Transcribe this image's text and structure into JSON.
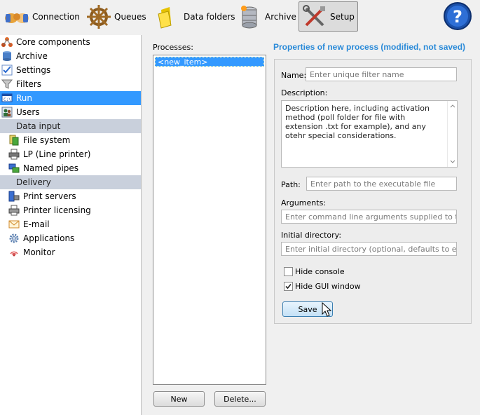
{
  "toolbar": {
    "connection": "Connection",
    "queues": "Queues",
    "data_folders": "Data folders",
    "archive": "Archive",
    "setup": "Setup"
  },
  "nav": {
    "items": [
      {
        "label": "Core components",
        "icon": "core-components-icon"
      },
      {
        "label": "Archive",
        "icon": "database-icon"
      },
      {
        "label": "Settings",
        "icon": "checklist-icon"
      },
      {
        "label": "Filters",
        "icon": "funnel-icon"
      },
      {
        "label": "Run",
        "icon": "run-icon"
      },
      {
        "label": "Users",
        "icon": "users-icon"
      }
    ],
    "group_data_input": "Data input",
    "data_input_items": [
      {
        "label": "File system"
      },
      {
        "label": "LP (Line printer)"
      },
      {
        "label": "Named pipes"
      }
    ],
    "group_delivery": "Delivery",
    "delivery_items": [
      {
        "label": "Print servers"
      },
      {
        "label": "Printer licensing"
      },
      {
        "label": "E-mail"
      },
      {
        "label": "Applications"
      },
      {
        "label": "Monitor"
      }
    ]
  },
  "processes": {
    "label": "Processes:",
    "items": [
      "<new_item>"
    ],
    "new_button": "New",
    "delete_button": "Delete..."
  },
  "properties": {
    "title": "Properties of new process (modified, not saved)",
    "name_label": "Name:",
    "name_placeholder": "Enter unique filter name",
    "description_label": "Description:",
    "description_value": "Description here, including activation method (poll folder for file with extension .txt for example), and any otehr special considerations.",
    "path_label": "Path:",
    "path_placeholder": "Enter path to the executable file",
    "arguments_label": "Arguments:",
    "arguments_placeholder": "Enter command line arguments supplied to the filte",
    "initial_dir_label": "Initial directory:",
    "initial_dir_placeholder": "Enter initial directory (optional, defaults to executa",
    "hide_console_label": "Hide console",
    "hide_console_checked": false,
    "hide_gui_label": "Hide GUI window",
    "hide_gui_checked": true,
    "save_button": "Save"
  },
  "colors": {
    "selection": "#3399ff",
    "title_accent": "#2a8ad8",
    "group_header": "#c9d0dc"
  }
}
